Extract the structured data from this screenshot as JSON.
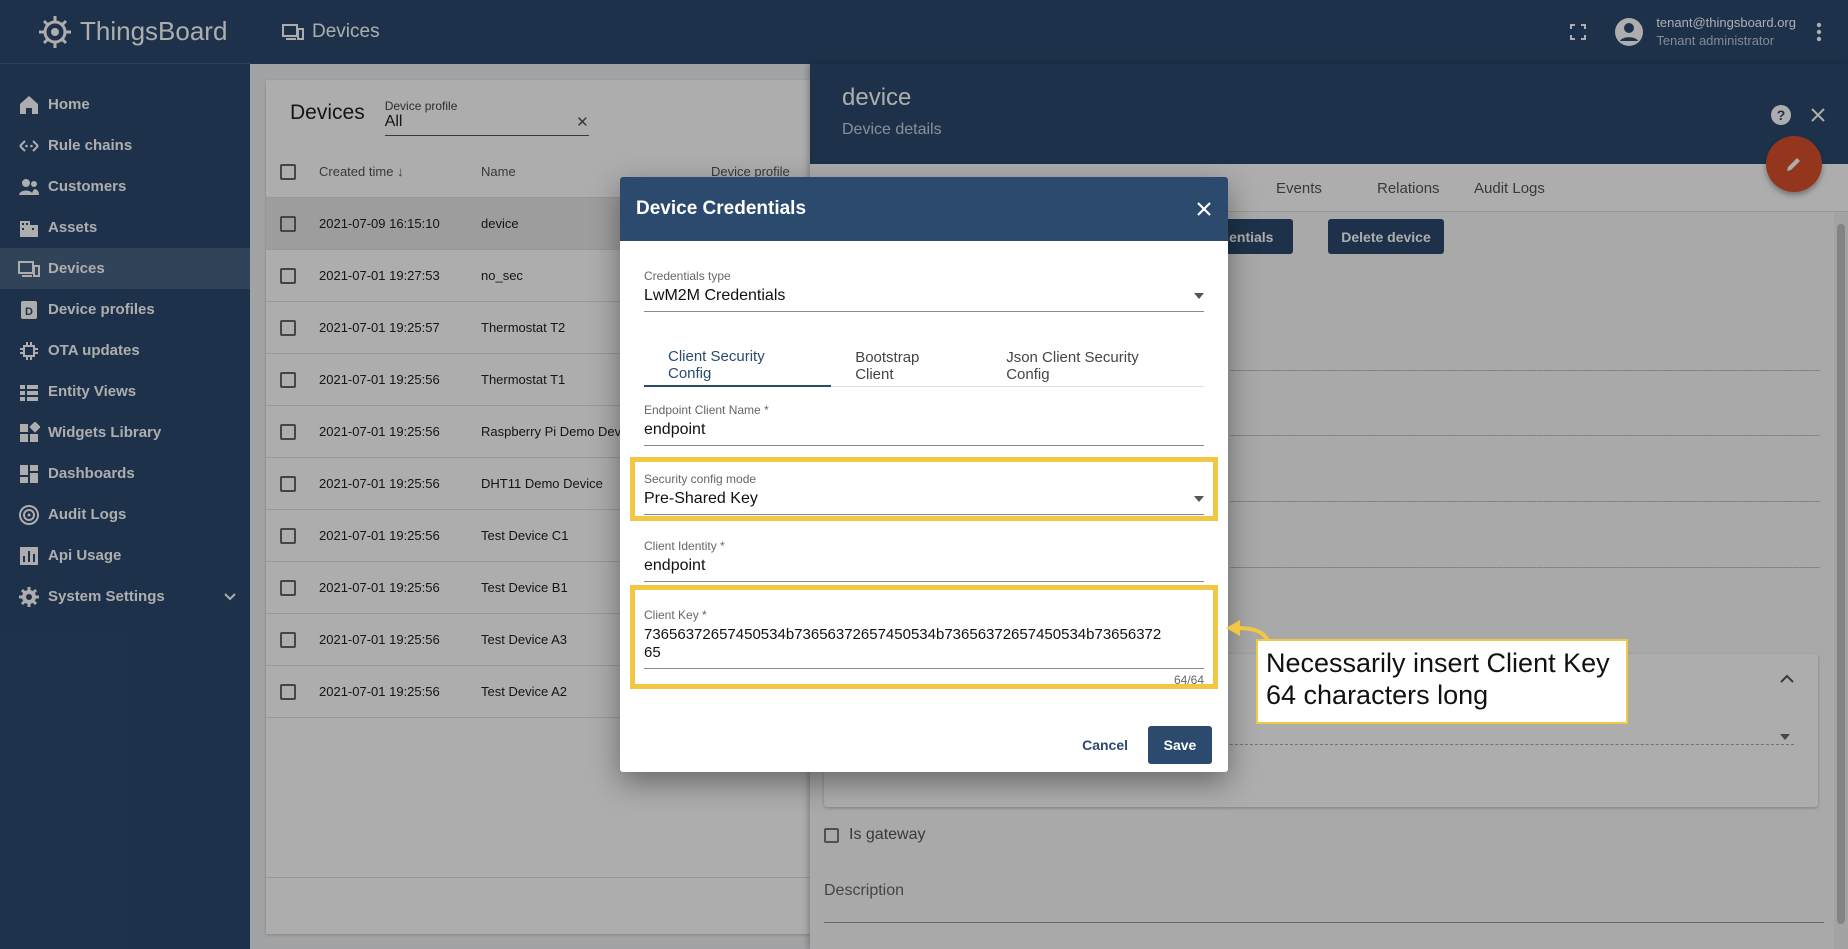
{
  "app": {
    "brand": "ThingsBoard",
    "page_title": "Devices"
  },
  "user": {
    "email": "tenant@thingsboard.org",
    "role": "Tenant administrator"
  },
  "sidebar": {
    "items": [
      {
        "label": "Home",
        "icon": "home-icon"
      },
      {
        "label": "Rule chains",
        "icon": "rule-chains-icon"
      },
      {
        "label": "Customers",
        "icon": "customers-icon"
      },
      {
        "label": "Assets",
        "icon": "assets-icon"
      },
      {
        "label": "Devices",
        "icon": "devices-icon",
        "active": true
      },
      {
        "label": "Device profiles",
        "icon": "device-profiles-icon"
      },
      {
        "label": "OTA updates",
        "icon": "ota-updates-icon"
      },
      {
        "label": "Entity Views",
        "icon": "entity-views-icon"
      },
      {
        "label": "Widgets Library",
        "icon": "widgets-library-icon"
      },
      {
        "label": "Dashboards",
        "icon": "dashboards-icon"
      },
      {
        "label": "Audit Logs",
        "icon": "audit-logs-icon"
      },
      {
        "label": "Api Usage",
        "icon": "api-usage-icon"
      },
      {
        "label": "System Settings",
        "icon": "settings-icon"
      }
    ]
  },
  "devices_panel": {
    "title": "Devices",
    "filter": {
      "label": "Device profile",
      "value": "All"
    },
    "columns": {
      "created_time": "Created time",
      "name": "Name",
      "profile": "Device profile"
    },
    "rows": [
      {
        "time": "2021-07-09 16:15:10",
        "name": "device"
      },
      {
        "time": "2021-07-01 19:27:53",
        "name": "no_sec"
      },
      {
        "time": "2021-07-01 19:25:57",
        "name": "Thermostat T2"
      },
      {
        "time": "2021-07-01 19:25:56",
        "name": "Thermostat T1"
      },
      {
        "time": "2021-07-01 19:25:56",
        "name": "Raspberry Pi Demo Devi"
      },
      {
        "time": "2021-07-01 19:25:56",
        "name": "DHT11 Demo Device"
      },
      {
        "time": "2021-07-01 19:25:56",
        "name": "Test Device C1"
      },
      {
        "time": "2021-07-01 19:25:56",
        "name": "Test Device B1"
      },
      {
        "time": "2021-07-01 19:25:56",
        "name": "Test Device A3"
      },
      {
        "time": "2021-07-01 19:25:56",
        "name": "Test Device A2"
      }
    ]
  },
  "details": {
    "name": "device",
    "subtitle": "Device details",
    "tabs": [
      "Events",
      "Relations",
      "Audit Logs"
    ],
    "credentials_button": "credentials",
    "delete_button": "Delete device",
    "is_gateway_label": "Is gateway",
    "description_label": "Description"
  },
  "dialog": {
    "title": "Device Credentials",
    "credentials_type": {
      "label": "Credentials type",
      "value": "LwM2M Credentials"
    },
    "tabs": [
      "Client Security Config",
      "Bootstrap Client",
      "Json Client Security Config"
    ],
    "endpoint": {
      "label": "Endpoint Client Name *",
      "value": "endpoint"
    },
    "security_mode": {
      "label": "Security config mode",
      "value": "Pre-Shared Key"
    },
    "client_identity": {
      "label": "Client Identity *",
      "value": "endpoint"
    },
    "client_key": {
      "label": "Client Key *",
      "value": "73656372657450534b73656372657450534b73656372657450534b7365637265",
      "line1": "73656372657450534b73656372657450534b73656372657450534b73656372",
      "line2": "65",
      "counter": "64/64"
    },
    "cancel": "Cancel",
    "save": "Save"
  },
  "annotation": {
    "line1": "Necessarily insert Client Key",
    "line2": "64 characters long",
    "color": "#f2c744"
  },
  "colors": {
    "primary": "#2b4a6e",
    "accent": "#d9502c"
  }
}
